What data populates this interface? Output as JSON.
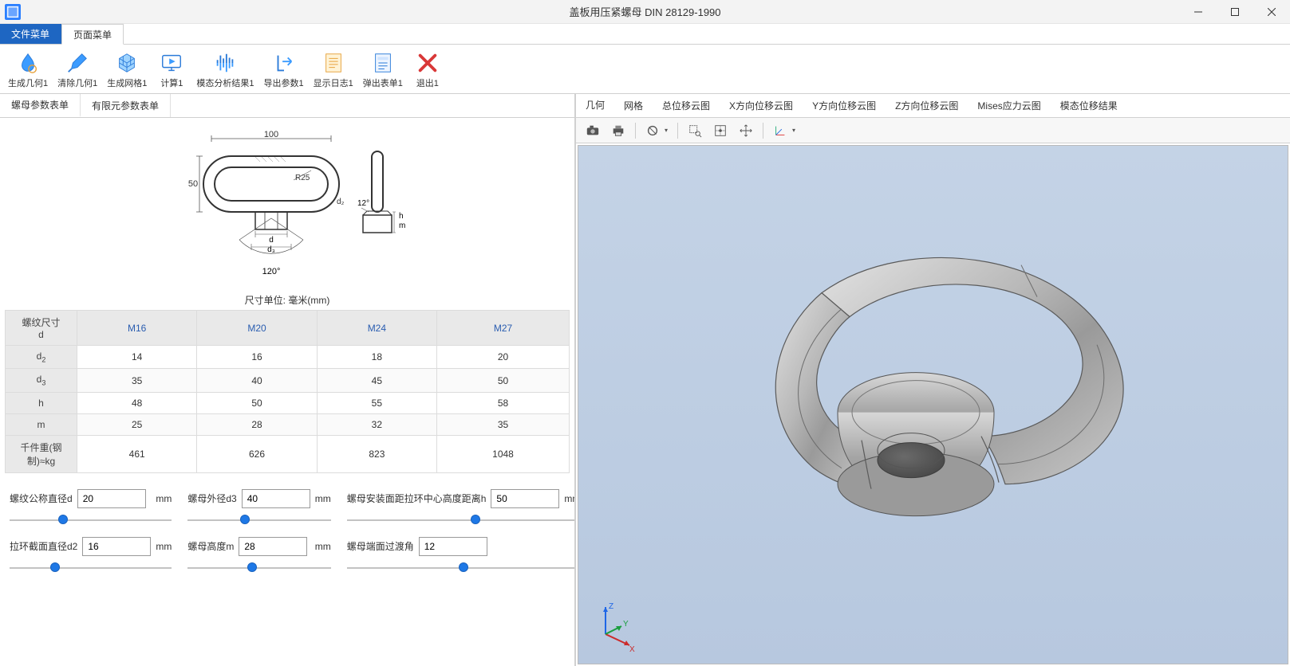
{
  "window": {
    "title": "盖板用压紧螺母 DIN 28129-1990"
  },
  "menu_tabs": {
    "file": "文件菜单",
    "page": "页面菜单"
  },
  "ribbon": {
    "gen_geom": "生成几何1",
    "clear_geom": "清除几何1",
    "gen_mesh": "生成网格1",
    "calc": "计算1",
    "modal_result": "模态分析结果1",
    "export_param": "导出参数1",
    "show_log": "显示日志1",
    "popup_form": "弹出表单1",
    "exit": "退出1"
  },
  "left_tabs": {
    "nut_params": "螺母参数表单",
    "fem_params": "有限元参数表单"
  },
  "diagram": {
    "w_label": "100",
    "h_label": "50",
    "r_label": "R25",
    "d2_label": "d₂",
    "angle_top": "12°",
    "h_sym": "h",
    "m_sym": "m",
    "d_sym": "d",
    "d3_sym": "d₃",
    "angle_bottom": "120°"
  },
  "caption": "尺寸单位: 毫米(mm)",
  "table": {
    "head_dim": "螺纹尺寸\nd",
    "cols": [
      "M16",
      "M20",
      "M24",
      "M27"
    ],
    "rows": [
      {
        "name_html": "d<span class='sub2'>2</span>",
        "vals": [
          "14",
          "16",
          "18",
          "20"
        ]
      },
      {
        "name_html": "d<span class='sub2'>3</span>",
        "vals": [
          "35",
          "40",
          "45",
          "50"
        ]
      },
      {
        "name_html": "h",
        "vals": [
          "48",
          "50",
          "55",
          "58"
        ]
      },
      {
        "name_html": "m",
        "vals": [
          "25",
          "28",
          "32",
          "35"
        ]
      },
      {
        "name_html": "千件重(钢制)≈kg",
        "vals": [
          "461",
          "626",
          "823",
          "1048"
        ]
      }
    ]
  },
  "params": {
    "p1": {
      "label": "螺纹公称直径d",
      "value": "20",
      "unit": "mm",
      "thumb_pct": 33
    },
    "p2": {
      "label": "螺母外径d3",
      "value": "40",
      "unit": "mm",
      "thumb_pct": 40
    },
    "p3": {
      "label": "螺母安装面距拉环中心高度距离h",
      "value": "50",
      "unit": "mm",
      "thumb_pct": 55
    },
    "p4": {
      "label": "拉环截面直径d2",
      "value": "16",
      "unit": "mm",
      "thumb_pct": 28
    },
    "p5": {
      "label": "螺母高度m",
      "value": "28",
      "unit": "mm",
      "thumb_pct": 45
    },
    "p6": {
      "label": "螺母端面过渡角",
      "value": "12",
      "unit": "°",
      "thumb_pct": 50
    }
  },
  "right_tabs": {
    "geom": "几何",
    "mesh": "网格",
    "total_disp": "总位移云图",
    "xdisp": "X方向位移云图",
    "ydisp": "Y方向位移云图",
    "zdisp": "Z方向位移云图",
    "mises": "Mises应力云图",
    "modal": "模态位移结果"
  },
  "axis": {
    "x": "X",
    "y": "Y",
    "z": "Z"
  }
}
